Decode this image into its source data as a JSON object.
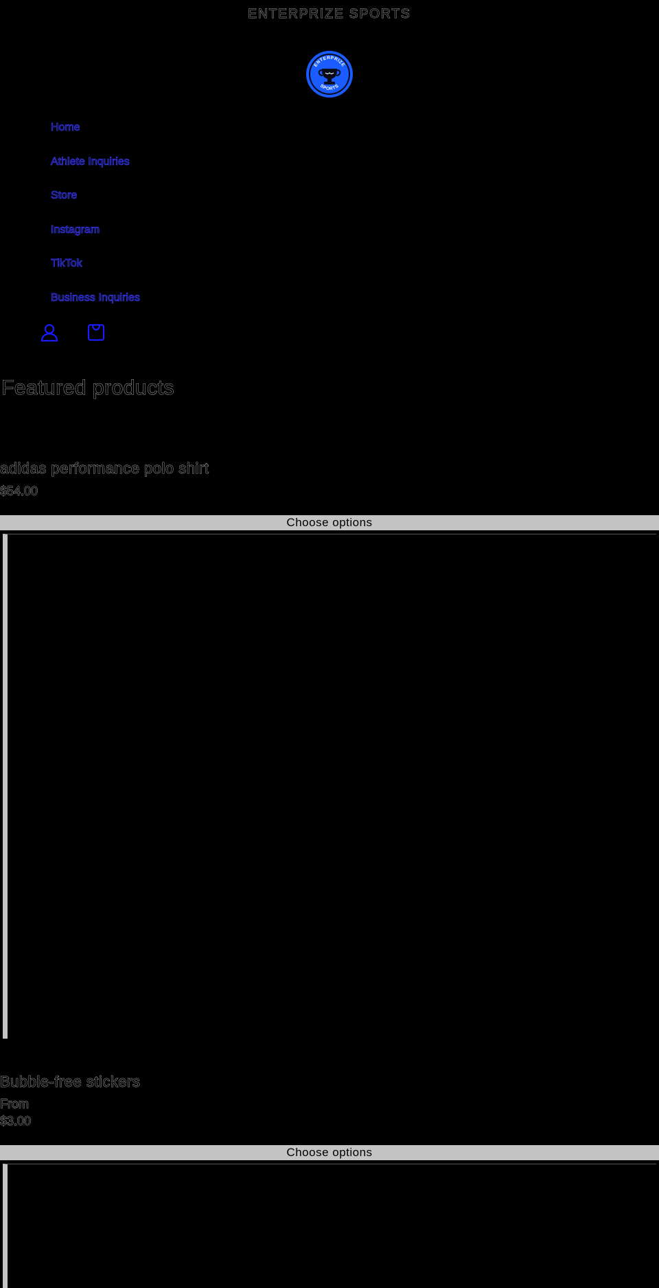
{
  "header": {
    "announcement": "ENTERPRIZE SPORTS",
    "logo": {
      "top_text": "ENTERPRIZE",
      "bottom_text": "SPORTS",
      "colors": {
        "ring": "#1a5cff",
        "inner": "#1a5cff",
        "trophy": "#0a0a1a"
      }
    },
    "nav": [
      {
        "label": "Home"
      },
      {
        "label": "Athlete Inquiries"
      },
      {
        "label": "Store"
      },
      {
        "label": "Instagram"
      },
      {
        "label": "TikTok"
      },
      {
        "label": "Business Inquiries"
      }
    ],
    "icons": [
      "account-icon",
      "cart-icon"
    ],
    "icon_color": "#1a1aff"
  },
  "featured": {
    "title": "Featured products",
    "products": [
      {
        "title": "adidas performance polo shirt",
        "from": "",
        "price": "$54.00",
        "button": "Choose options"
      },
      {
        "title": "Bubble-free stickers",
        "from": "From",
        "price": "$3.00",
        "button": "Choose options"
      }
    ]
  },
  "colors": {
    "background": "#000000",
    "button": "#c3c3c3",
    "nav_link": "#3a3aff"
  }
}
